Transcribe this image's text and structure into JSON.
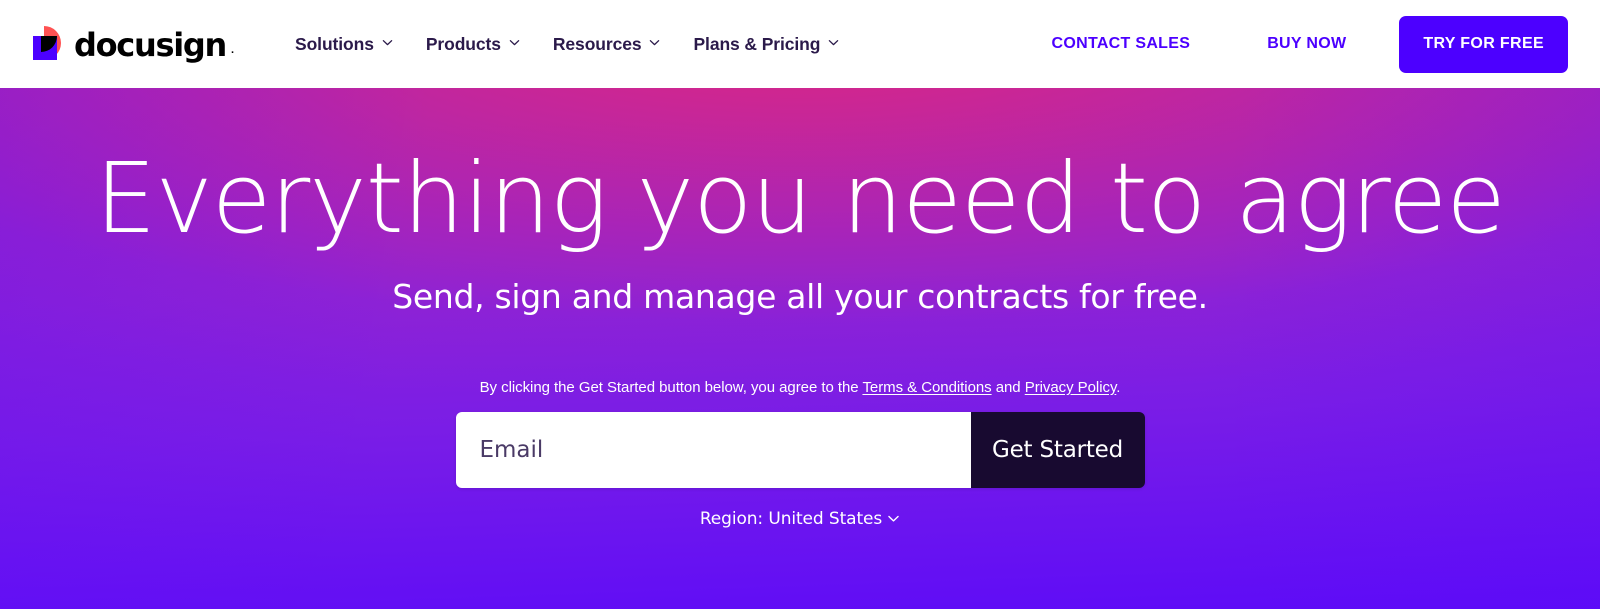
{
  "brand": {
    "name": "docusign",
    "trademark": ".",
    "logo_icon": "docusign-logo-mark",
    "colors": {
      "logo_red": "#FF5252",
      "logo_blue": "#4C00FF",
      "logo_black": "#000000",
      "accent": "#4C00FF",
      "nav_text": "#2B1A4A",
      "submit_dark": "#180A30"
    }
  },
  "header": {
    "nav": [
      {
        "label": "Solutions",
        "icon": "chevron-down-icon"
      },
      {
        "label": "Products",
        "icon": "chevron-down-icon"
      },
      {
        "label": "Resources",
        "icon": "chevron-down-icon"
      },
      {
        "label": "Plans & Pricing",
        "icon": "chevron-down-icon"
      }
    ],
    "contact_sales": "CONTACT SALES",
    "buy_now": "BUY NOW",
    "try_for_free": "TRY FOR FREE"
  },
  "hero": {
    "headline": "Everything you need to agree",
    "subheadline": "Send, sign and manage all your contracts for free.",
    "legal": {
      "prefix": "By clicking the Get Started button below, you agree to the ",
      "terms_link": "Terms & Conditions",
      "conjunction": " and ",
      "privacy_link": "Privacy Policy",
      "suffix": "."
    },
    "form": {
      "email_placeholder": "Email",
      "email_value": "",
      "submit_label": "Get Started"
    },
    "region": {
      "label": "Region: United States",
      "icon": "chevron-down-icon"
    }
  }
}
